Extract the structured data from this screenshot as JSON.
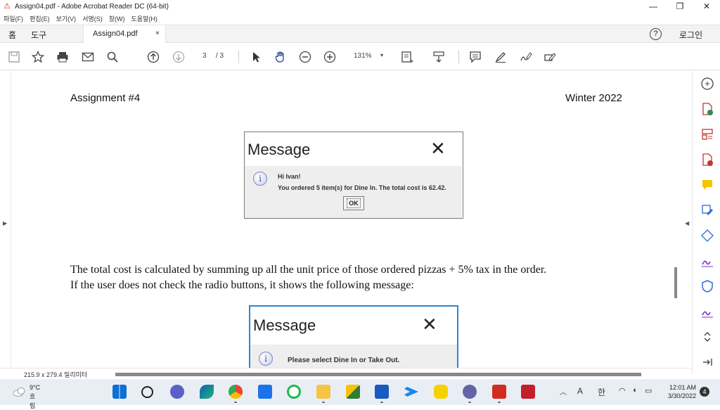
{
  "window": {
    "title": "Assign04.pdf - Adobe Acrobat Reader DC (64-bit)",
    "controls": {
      "minimize": "—",
      "maximize": "❐",
      "close": "✕"
    }
  },
  "menu": [
    "파일(F)",
    "편집(E)",
    "보기(V)",
    "서명(S)",
    "창(W)",
    "도움말(H)"
  ],
  "tabs": {
    "home": "홈",
    "tools": "도구",
    "doc": "Assign04.pdf",
    "doc_close": "×",
    "help": "?",
    "login": "로그인"
  },
  "toolbar": {
    "page_current": "3",
    "page_total": "/ 3",
    "zoom": "131%",
    "zoom_caret": "▾"
  },
  "document": {
    "header_left": "Assignment #4",
    "header_right": "Winter 2022",
    "dialog1": {
      "title": "Message",
      "close": "✕",
      "line1": "Hi Ivan!",
      "line2": "You ordered 5 item(s) for Dine In. The total cost is 62.42.",
      "ok": "OK"
    },
    "paragraph_line1": "The total cost is calculated by summing up all the unit price of those ordered pizzas + 5% tax in the order.",
    "paragraph_line2": "If the user does not check the radio buttons, it shows the following message:",
    "dialog2": {
      "title": "Message",
      "close": "✕",
      "line1": "Please select Dine In or Take Out."
    }
  },
  "status": {
    "page_size": "215.9 x 279.4 밀리미터"
  },
  "taskbar": {
    "temp": "9°C",
    "weather": "흐림",
    "tray_a": "A",
    "tray_ime": "한",
    "time": "12:01 AM",
    "date": "3/30/2022",
    "notifications": "4",
    "colors": {
      "accent": "#2d86d6",
      "acrobat_red": "#d42b1e"
    }
  }
}
